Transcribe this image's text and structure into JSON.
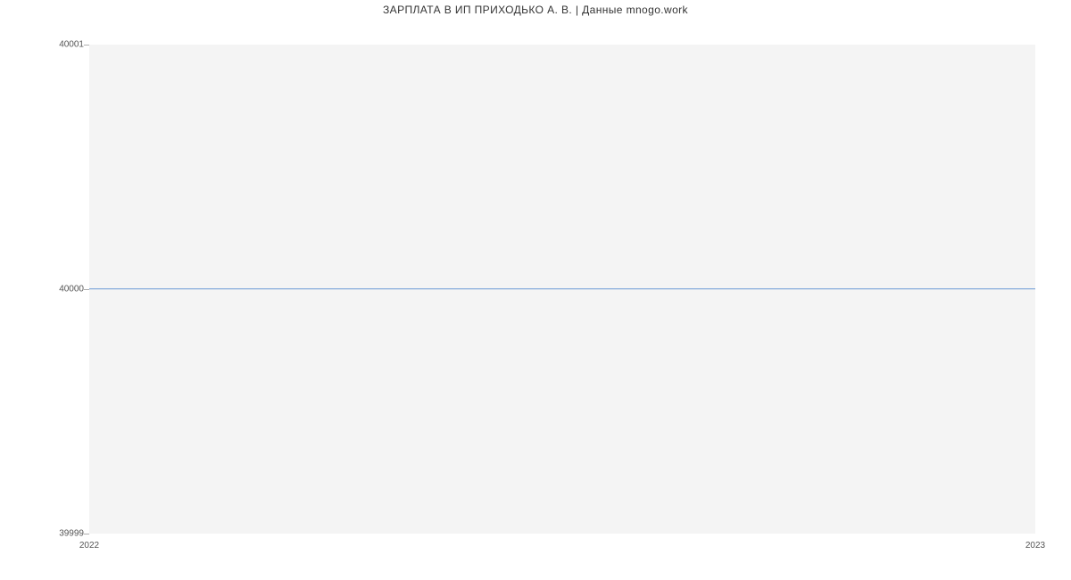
{
  "chart_data": {
    "type": "line",
    "title": "ЗАРПЛАТА В ИП ПРИХОДЬКО А. В. | Данные mnogo.work",
    "xlabel": "",
    "ylabel": "",
    "x": [
      2022,
      2023
    ],
    "values": [
      40000,
      40000
    ],
    "xlim": [
      2022,
      2023
    ],
    "ylim": [
      39999,
      40001
    ],
    "x_ticks": [
      2022,
      2023
    ],
    "y_ticks": [
      39999,
      40000,
      40001
    ],
    "line_color": "#6e9bd6",
    "plot_bg": "#f4f4f4"
  }
}
